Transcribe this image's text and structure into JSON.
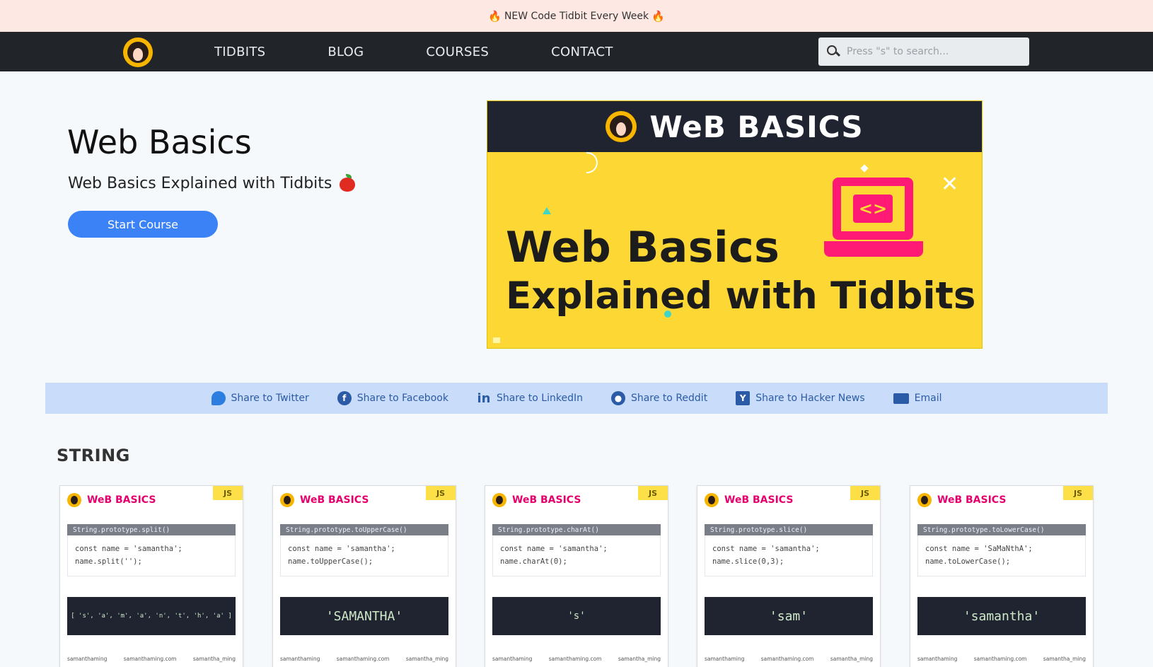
{
  "announcement": {
    "text": "NEW Code Tidbit Every Week"
  },
  "nav": {
    "links": [
      "TIDBITS",
      "BLOG",
      "COURSES",
      "CONTACT"
    ],
    "search_placeholder": "Press \"s\" to search..."
  },
  "hero": {
    "title": "Web Basics",
    "subtitle": "Web Basics Explained with Tidbits",
    "button": "Start Course"
  },
  "banner": {
    "brand": "WeB BASICS",
    "line1": "Web Basics",
    "line2": "Explained with Tidbits",
    "code_glyph": "<>"
  },
  "share": [
    {
      "label": "Share to Twitter",
      "icon": "twitter-icon"
    },
    {
      "label": "Share to Facebook",
      "icon": "facebook-icon"
    },
    {
      "label": "Share to LinkedIn",
      "icon": "linkedin-icon"
    },
    {
      "label": "Share to Reddit",
      "icon": "reddit-icon"
    },
    {
      "label": "Share to Hacker News",
      "icon": "hacker-news-icon"
    },
    {
      "label": "Email",
      "icon": "email-icon"
    }
  ],
  "section": {
    "title": "STRING"
  },
  "cards": [
    {
      "tag": "JS",
      "brand": "WeB BASICS",
      "proto": "String.prototype.split()",
      "code1": "const name = 'samantha';",
      "code2": "name.split('');",
      "output": "[ 's', 'a', 'm', 'a', 'n', 't', 'h', 'a' ]",
      "foot": [
        "samanthaming",
        "samanthaming.com",
        "samantha_ming"
      ]
    },
    {
      "tag": "JS",
      "brand": "WeB BASICS",
      "proto": "String.prototype.toUpperCase()",
      "code1": "const name = 'samantha';",
      "code2": "name.toUpperCase();",
      "output": "'SAMANTHA'",
      "foot": [
        "samanthaming",
        "samanthaming.com",
        "samantha_ming"
      ]
    },
    {
      "tag": "JS",
      "brand": "WeB BASICS",
      "proto": "String.prototype.charAt()",
      "code1": "const name = 'samantha';",
      "code2": "name.charAt(0);",
      "output": "'s'",
      "foot": [
        "samanthaming",
        "samanthaming.com",
        "samantha_ming"
      ]
    },
    {
      "tag": "JS",
      "brand": "WeB BASICS",
      "proto": "String.prototype.slice()",
      "code1": "const name = 'samantha';",
      "code2": "name.slice(0,3);",
      "output": "'sam'",
      "foot": [
        "samanthaming",
        "samanthaming.com",
        "samantha_ming"
      ]
    },
    {
      "tag": "JS",
      "brand": "WeB BASICS",
      "proto": "String.prototype.toLowerCase()",
      "code1": "const name = 'SaMaNthA';",
      "code2": "name.toLowerCase();",
      "output": "'samantha'",
      "foot": [
        "samanthaming",
        "samanthaming.com",
        "samantha_ming"
      ]
    }
  ],
  "colors": {
    "accent": "#3b82f6",
    "nav_bg": "#212529",
    "share_bg": "#c9ddfb",
    "banner_yellow": "#fdd835",
    "brand_pink": "#e6006e"
  }
}
